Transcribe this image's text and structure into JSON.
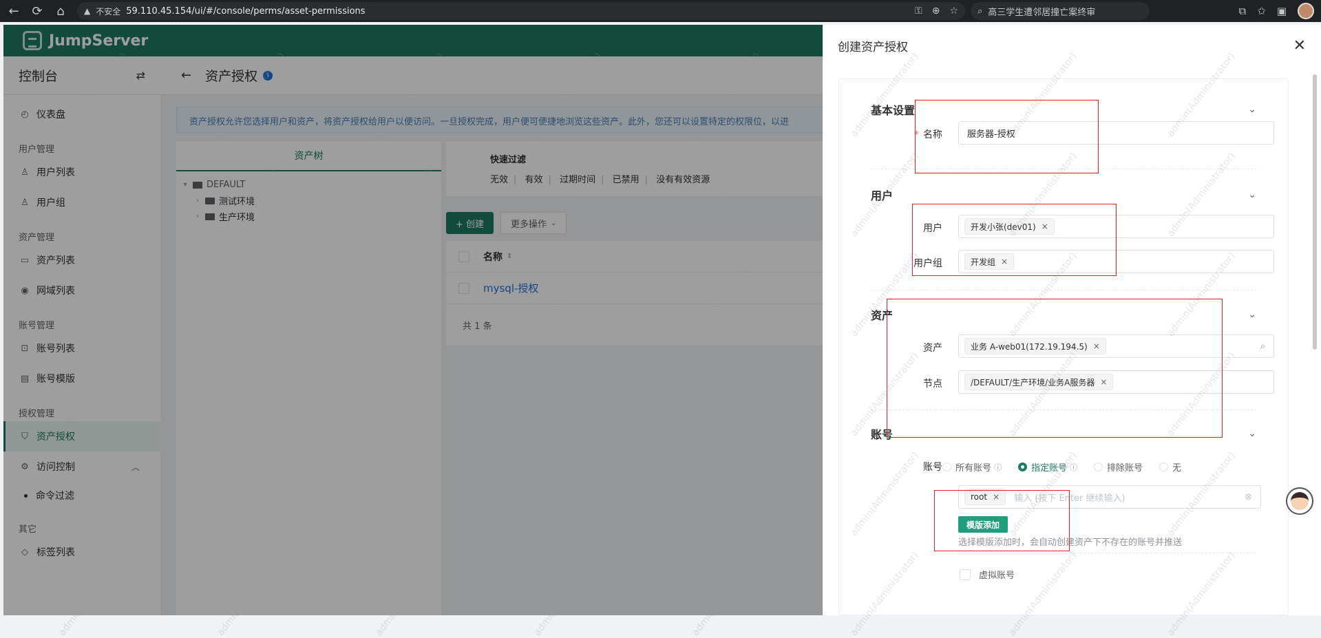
{
  "browser": {
    "not_secure": "不安全",
    "url": "59.110.45.154/ui/#/console/perms/asset-permissions",
    "search_text": "高三学生遭邻居撞亡案终审"
  },
  "app": {
    "logo_text": "JumpServer"
  },
  "sidebar": {
    "title": "控制台",
    "groups": {
      "dashboard": "仪表盘",
      "user_mgmt": "用户管理",
      "user_list": "用户列表",
      "user_group": "用户组",
      "asset_mgmt": "资产管理",
      "asset_list": "资产列表",
      "domain_list": "网域列表",
      "account_mgmt": "账号管理",
      "account_list": "账号列表",
      "account_template": "账号模版",
      "perm_mgmt": "授权管理",
      "asset_perm": "资产授权",
      "access_control": "访问控制",
      "command_filter": "命令过滤",
      "other": "其它",
      "label_list": "标签列表"
    }
  },
  "main": {
    "title": "资产授权",
    "info_text": "资产授权允许您选择用户和资产，将资产授权给用户以便访问。一旦授权完成，用户便可便捷地浏览这些资产。此外，您还可以设置特定的权限位，以进",
    "tree_tab": "资产树",
    "tree": {
      "root": "DEFAULT",
      "child1": "测试环境",
      "child2": "生产环境"
    },
    "quick_filter_title": "快速过滤",
    "filters": [
      "无效",
      "有效",
      "过期时间",
      "已禁用",
      "没有有效资源"
    ],
    "create_btn": "+ 创建",
    "more_btn": "更多操作",
    "col_name": "名称",
    "row1": "mysql-授权",
    "total": "共 1 条"
  },
  "drawer": {
    "title": "创建资产授权",
    "sections": {
      "basic": "基本设置",
      "users": "用户",
      "assets": "资产",
      "accounts": "账号"
    },
    "fields": {
      "name_label": "名称",
      "name_value": "服务器-授权",
      "user_label": "用户",
      "user_tag": "开发小张(dev01)",
      "group_label": "用户组",
      "group_tag": "开发组",
      "asset_label": "资产",
      "asset_tag": "业务 A-web01(172.19.194.5)",
      "node_label": "节点",
      "node_tag": "/DEFAULT/生产环境/业务A服务器",
      "account_label": "账号",
      "radio_all": "所有账号",
      "radio_specified": "指定账号",
      "radio_exclude": "排除账号",
      "radio_none": "无",
      "account_tag": "root",
      "account_placeholder": "输入 (按下 Enter 继续输入)",
      "template_btn": "模版添加",
      "hint": "选择模版添加时，会自动创建资产下不存在的账号并推送",
      "virtual_account": "虚拟账号"
    }
  },
  "watermark": "admin(Administrator)",
  "colors": {
    "brand": "#1d7a62",
    "highlight_box": "#e81c1c"
  }
}
